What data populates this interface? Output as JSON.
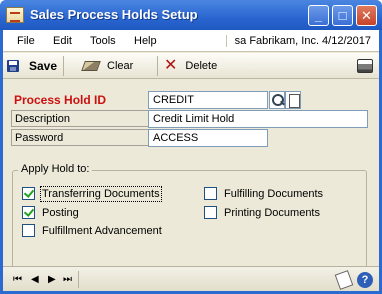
{
  "window": {
    "title": "Sales Process Holds Setup",
    "minimize_glyph": "_",
    "maximize_glyph": "□",
    "close_glyph": "✕"
  },
  "menu": {
    "items": [
      "File",
      "Edit",
      "Tools",
      "Help"
    ],
    "company": "sa  Fabrikam, Inc.  4/12/2017"
  },
  "toolbar": {
    "save_label": "Save",
    "clear_label": "Clear",
    "delete_label": "Delete"
  },
  "form": {
    "process_hold_id_label": "Process Hold ID",
    "process_hold_id_value": "CREDIT",
    "description_label": "Description",
    "description_value": "Credit Limit Hold",
    "password_label": "Password",
    "password_value": "ACCESS"
  },
  "apply_hold": {
    "title": "Apply Hold to:",
    "options": [
      {
        "label": "Transferring Documents",
        "checked": true
      },
      {
        "label": "Posting",
        "checked": true
      },
      {
        "label": "Fulfillment Advancement",
        "checked": false
      },
      {
        "label": "Fulfilling Documents",
        "checked": false
      },
      {
        "label": "Printing Documents",
        "checked": false
      }
    ]
  },
  "statusbar": {
    "nav_first": "⏮",
    "nav_prev": "◀",
    "nav_next": "▶",
    "nav_last": "⏭",
    "help_glyph": "?"
  }
}
